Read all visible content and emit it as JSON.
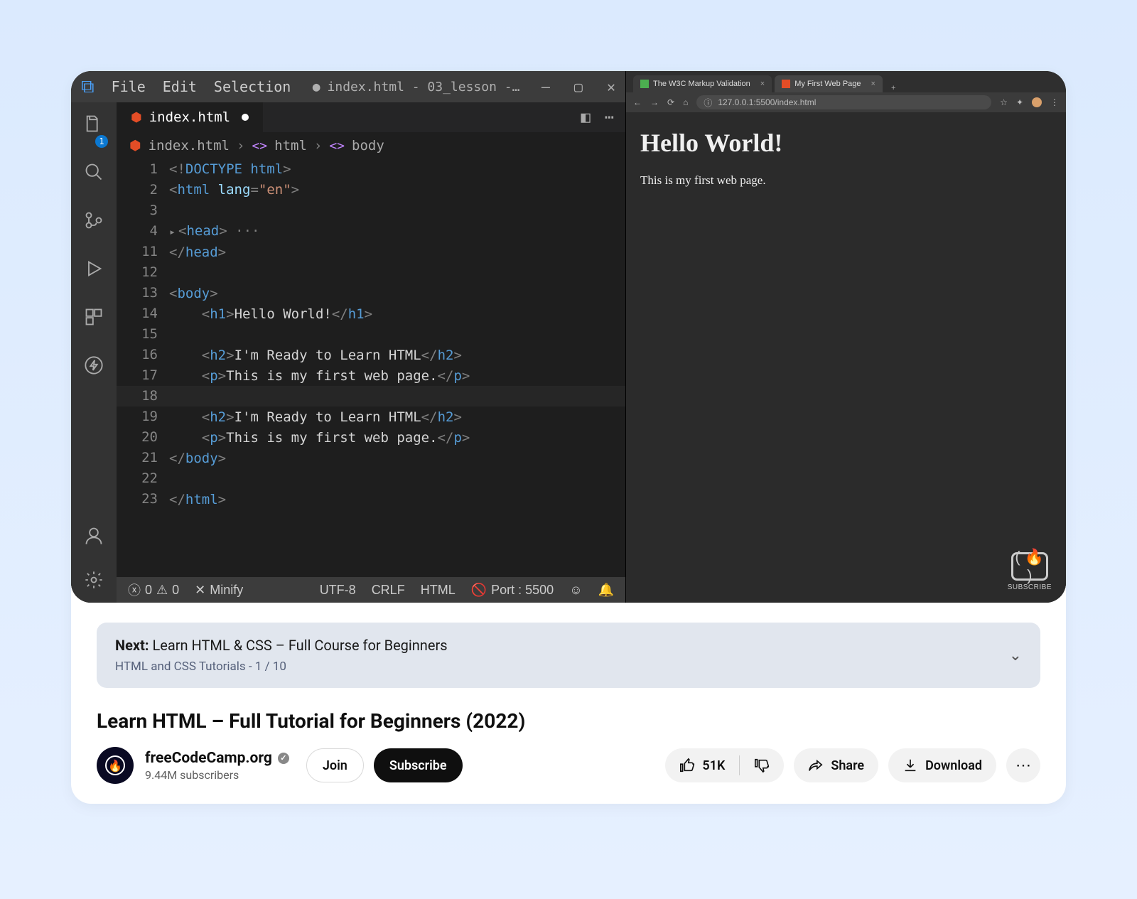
{
  "vscode": {
    "menu": [
      "File",
      "Edit",
      "Selection"
    ],
    "windowTitle": "index.html - 03_lesson -…",
    "tab": {
      "label": "index.html"
    },
    "breadcrumbs": [
      "index.html",
      "html",
      "body"
    ],
    "activityBadge": "1",
    "code": {
      "lines": [
        {
          "n": 1,
          "html": "<span class='c-punc'>&lt;!</span><span class='c-doctype'>DOCTYPE html</span><span class='c-punc'>&gt;</span>"
        },
        {
          "n": 2,
          "html": "<span class='c-punc'>&lt;</span><span class='c-tag'>html</span> <span class='c-attr'>lang</span><span class='c-punc'>=</span><span class='c-str'>\"en\"</span><span class='c-punc'>&gt;</span>"
        },
        {
          "n": 3,
          "html": ""
        },
        {
          "n": 4,
          "html": "<span class='fold'>▸</span><span class='c-punc'>&lt;</span><span class='c-tag'>head</span><span class='c-punc'>&gt;</span> <span class='c-punc'>···</span>"
        },
        {
          "n": 11,
          "html": "<span class='c-punc'>&lt;/</span><span class='c-tag'>head</span><span class='c-punc'>&gt;</span>"
        },
        {
          "n": 12,
          "html": ""
        },
        {
          "n": 13,
          "html": "<span class='c-punc'>&lt;</span><span class='c-tag'>body</span><span class='c-punc'>&gt;</span>"
        },
        {
          "n": 14,
          "html": "    <span class='c-punc'>&lt;</span><span class='c-tag'>h1</span><span class='c-punc'>&gt;</span>Hello World!<span class='c-punc'>&lt;/</span><span class='c-tag'>h1</span><span class='c-punc'>&gt;</span>"
        },
        {
          "n": 15,
          "html": ""
        },
        {
          "n": 16,
          "html": "    <span class='c-punc'>&lt;</span><span class='c-tag'>h2</span><span class='c-punc'>&gt;</span>I'm Ready to Learn HTML<span class='c-punc'>&lt;/</span><span class='c-tag'>h2</span><span class='c-punc'>&gt;</span>"
        },
        {
          "n": 17,
          "html": "    <span class='c-punc'>&lt;</span><span class='c-tag'>p</span><span class='c-punc'>&gt;</span>This is my first web page.<span class='c-punc'>&lt;/</span><span class='c-tag'>p</span><span class='c-punc'>&gt;</span>"
        },
        {
          "n": 18,
          "html": "",
          "hl": true
        },
        {
          "n": 19,
          "html": "    <span class='c-punc'>&lt;</span><span class='c-tag'>h2</span><span class='c-punc'>&gt;</span>I'm Ready to Learn HTML<span class='c-punc'>&lt;/</span><span class='c-tag'>h2</span><span class='c-punc'>&gt;</span>"
        },
        {
          "n": 20,
          "html": "    <span class='c-punc'>&lt;</span><span class='c-tag'>p</span><span class='c-punc'>&gt;</span>This is my first web page.<span class='c-punc'>&lt;/</span><span class='c-tag'>p</span><span class='c-punc'>&gt;</span>"
        },
        {
          "n": 21,
          "html": "<span class='c-punc'>&lt;/</span><span class='c-tag'>body</span><span class='c-punc'>&gt;</span>"
        },
        {
          "n": 22,
          "html": ""
        },
        {
          "n": 23,
          "html": "<span class='c-punc'>&lt;/</span><span class='c-tag'>html</span><span class='c-punc'>&gt;</span>"
        }
      ]
    },
    "status": {
      "errors": "0",
      "warnings": "0",
      "minify": "Minify",
      "encoding": "UTF-8",
      "eol": "CRLF",
      "lang": "HTML",
      "port": "Port : 5500"
    }
  },
  "browser": {
    "tabs": [
      {
        "title": "The W3C Markup Validation"
      },
      {
        "title": "My First Web Page",
        "active": true
      }
    ],
    "url": "127.0.0.1:5500/index.html",
    "page": {
      "h1": "Hello World!",
      "p": "This is my first web page."
    },
    "subscribe_overlay": "SUBSCRIBE"
  },
  "nextup": {
    "prefix": "Next:",
    "title": "Learn HTML & CSS – Full Course for Beginners",
    "playlist": "HTML and CSS Tutorials - 1 / 10"
  },
  "video_title": "Learn HTML – Full Tutorial for Beginners (2022)",
  "channel": {
    "name": "freeCodeCamp.org",
    "subs": "9.44M subscribers"
  },
  "buttons": {
    "join": "Join",
    "subscribe": "Subscribe",
    "likes": "51K",
    "share": "Share",
    "download": "Download"
  }
}
